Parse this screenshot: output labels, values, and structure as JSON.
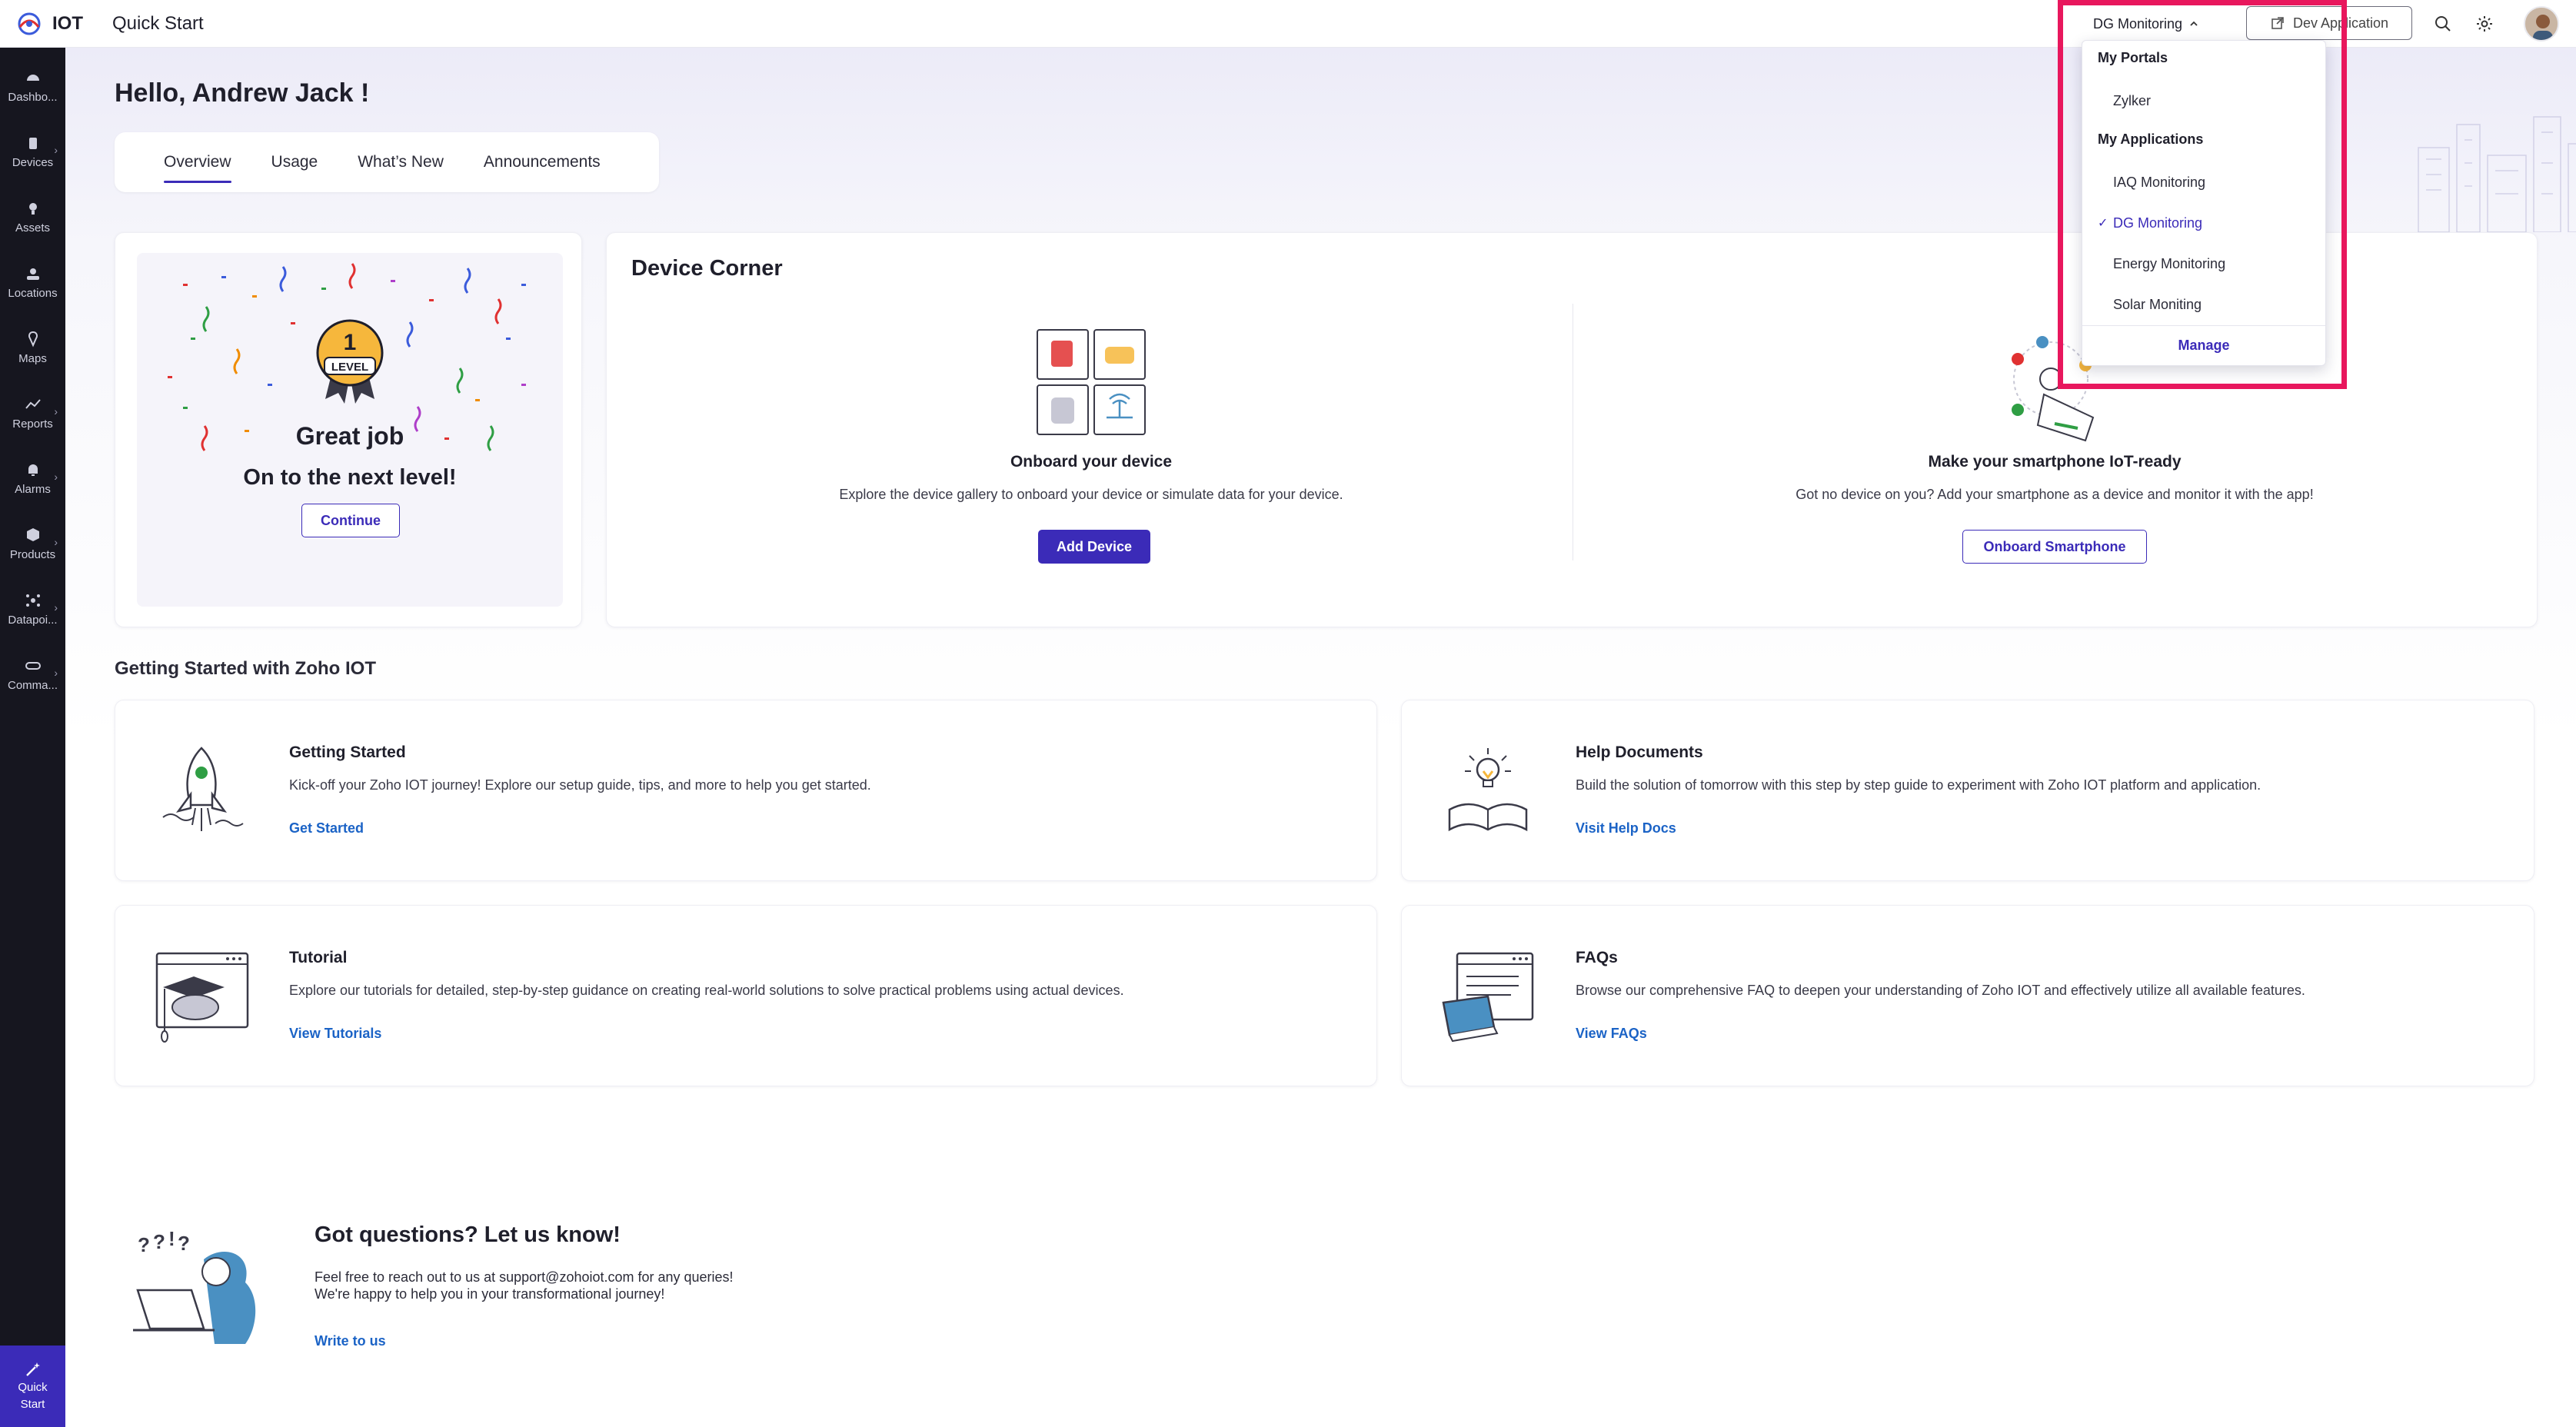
{
  "topbar": {
    "app_name": "IOT",
    "page_title": "Quick Start",
    "app_select_label": "DG Monitoring",
    "dev_button_label": "Dev Application"
  },
  "sidebar": {
    "items": [
      {
        "label": "Dashbo...",
        "icon": "dashboard-icon",
        "chevron": false
      },
      {
        "label": "Devices",
        "icon": "devices-icon",
        "chevron": true
      },
      {
        "label": "Assets",
        "icon": "assets-icon",
        "chevron": false
      },
      {
        "label": "Locations",
        "icon": "locations-icon",
        "chevron": false
      },
      {
        "label": "Maps",
        "icon": "maps-icon",
        "chevron": false
      },
      {
        "label": "Reports",
        "icon": "reports-icon",
        "chevron": true
      },
      {
        "label": "Alarms",
        "icon": "alarms-icon",
        "chevron": true
      },
      {
        "label": "Products",
        "icon": "products-icon",
        "chevron": true
      },
      {
        "label": "Datapoi...",
        "icon": "datapoints-icon",
        "chevron": true
      },
      {
        "label": "Comma...",
        "icon": "commands-icon",
        "chevron": true
      }
    ],
    "quick_start_line1": "Quick",
    "quick_start_line2": "Start"
  },
  "main": {
    "greeting": "Hello, Andrew Jack !",
    "tabs": [
      {
        "label": "Overview",
        "active": true
      },
      {
        "label": "Usage",
        "active": false
      },
      {
        "label": "What’s New",
        "active": false
      },
      {
        "label": "Announcements",
        "active": false
      }
    ]
  },
  "level_card": {
    "badge_number": "1",
    "badge_text": "LEVEL",
    "title": "Great job",
    "subtitle": "On to the next level!",
    "button": "Continue"
  },
  "device_corner": {
    "title": "Device Corner",
    "onboard": {
      "heading": "Onboard your device",
      "description": "Explore the device gallery to onboard your device or simulate data for your device.",
      "button": "Add Device"
    },
    "smartphone": {
      "heading": "Make your smartphone IoT-ready",
      "description": "Got no device on you? Add your smartphone as a device and monitor it with the app!",
      "button": "Onboard Smartphone"
    }
  },
  "getting_started": {
    "section_title": "Getting Started with Zoho IOT",
    "cards": [
      {
        "title": "Getting Started",
        "description": "Kick-off your Zoho IOT journey! Explore our setup guide, tips, and more to help you get started.",
        "link": "Get Started"
      },
      {
        "title": "Help Documents",
        "description": "Build the solution of tomorrow with this step by step guide to experiment with Zoho IOT platform and application.",
        "link": "Visit Help Docs"
      },
      {
        "title": "Tutorial",
        "description": "Explore our tutorials for detailed, step-by-step guidance on creating real-world solutions to solve practical problems using actual devices.",
        "link": "View Tutorials"
      },
      {
        "title": "FAQs",
        "description": "Browse our comprehensive FAQ to deepen your understanding of Zoho IOT and effectively utilize all available features.",
        "link": "View FAQs"
      }
    ]
  },
  "questions": {
    "title": "Got questions? Let us know!",
    "description": "Feel free to reach out to us at support@zohoiot.com for any queries! We're happy to help you in your transformational journey!",
    "link": "Write to us"
  },
  "dropdown": {
    "portals_header": "My Portals",
    "portals": [
      "Zylker"
    ],
    "applications_header": "My Applications",
    "applications": [
      "IAQ Monitoring",
      "DG Monitoring",
      "Energy Monitoring",
      "Solar Moniting"
    ],
    "selected_application": "DG Monitoring",
    "manage_label": "Manage"
  },
  "colors": {
    "accent": "#3b2bb8",
    "link": "#1b63c6",
    "sidebar_bg": "#16161f",
    "highlight": "#e8175d"
  }
}
